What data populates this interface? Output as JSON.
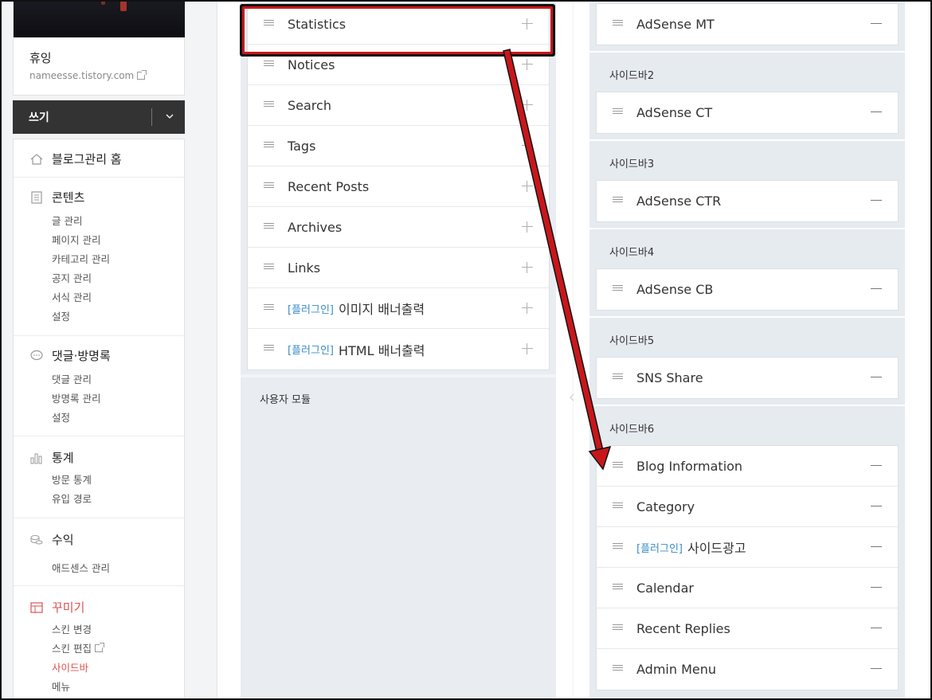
{
  "profile": {
    "name": "휴잉",
    "url": "nameesse.tistory.com"
  },
  "write_button": {
    "label": "쓰기"
  },
  "menu": {
    "home": "블로그관리 홈",
    "content": {
      "title": "콘텐츠",
      "items": [
        "글 관리",
        "페이지 관리",
        "카테고리 관리",
        "공지 관리",
        "서식 관리",
        "설정"
      ]
    },
    "comments": {
      "title": "댓글·방명록",
      "items": [
        "댓글 관리",
        "방명록 관리",
        "설정"
      ]
    },
    "stats": {
      "title": "통계",
      "items": [
        "방문 통계",
        "유입 경로"
      ]
    },
    "revenue": {
      "title": "수익",
      "items": [
        "애드센스 관리"
      ]
    },
    "decorate": {
      "title": "꾸미기",
      "items": [
        "스킨 변경",
        "스킨 편집",
        "사이드바",
        "메뉴"
      ]
    }
  },
  "modules": {
    "items": [
      {
        "label": "Statistics",
        "tag": ""
      },
      {
        "label": "Notices",
        "tag": ""
      },
      {
        "label": "Search",
        "tag": ""
      },
      {
        "label": "Tags",
        "tag": ""
      },
      {
        "label": "Recent Posts",
        "tag": ""
      },
      {
        "label": "Archives",
        "tag": ""
      },
      {
        "label": "Links",
        "tag": ""
      },
      {
        "label": "이미지 배너출력",
        "tag": "[플러그인]"
      },
      {
        "label": "HTML 배너출력",
        "tag": "[플러그인]"
      }
    ],
    "user_module_label": "사용자 모듈"
  },
  "sidebars": {
    "top_item": "AdSense MT",
    "sections": [
      {
        "label": "사이드바2",
        "items": [
          "AdSense CT"
        ]
      },
      {
        "label": "사이드바3",
        "items": [
          "AdSense CTR"
        ]
      },
      {
        "label": "사이드바4",
        "items": [
          "AdSense CB"
        ]
      },
      {
        "label": "사이드바5",
        "items": [
          "SNS Share"
        ]
      },
      {
        "label": "사이드바6",
        "items": [
          "Blog Information",
          "Category",
          "사이드광고",
          "Calendar",
          "Recent Replies",
          "Admin Menu"
        ]
      }
    ],
    "plugin_tag": "[플러그인]"
  },
  "colors": {
    "accent_red": "#d9534f",
    "annotation_red": "#c8171b",
    "plugin_blue": "#3a8cc8",
    "write_button_bg": "#333333"
  }
}
